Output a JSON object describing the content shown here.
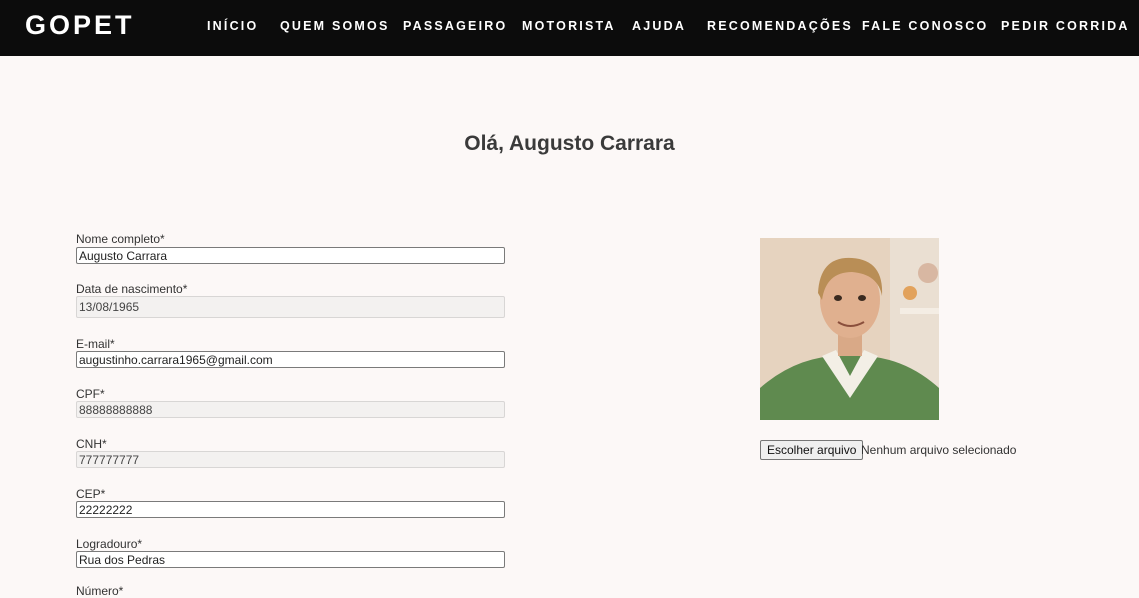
{
  "nav": {
    "logo": "GOPET",
    "items": [
      {
        "label": "INÍCIO"
      },
      {
        "label": "QUEM SOMOS"
      },
      {
        "label": "PASSAGEIRO"
      },
      {
        "label": "MOTORISTA"
      },
      {
        "label": "AJUDA"
      },
      {
        "label": "RECOMENDAÇÕES"
      },
      {
        "label": "FALE CONOSCO"
      },
      {
        "label": "PEDIR CORRIDA"
      }
    ]
  },
  "greeting": "Olá, Augusto Carrara",
  "form": {
    "fields": [
      {
        "label": "Nome completo*",
        "value": "Augusto Carrara"
      },
      {
        "label": "Data de nascimento*",
        "value": "13/08/1965"
      },
      {
        "label": "E-mail*",
        "value": "augustinho.carrara1965@gmail.com"
      },
      {
        "label": "CPF*",
        "value": "88888888888"
      },
      {
        "label": "CNH*",
        "value": "777777777"
      },
      {
        "label": "CEP*",
        "value": "22222222"
      },
      {
        "label": "Logradouro*",
        "value": "Rua dos Pedras"
      },
      {
        "label": "Número*",
        "value": ""
      }
    ]
  },
  "photo": {
    "button_label": "Escolher arquivo",
    "status": "Nenhum arquivo selecionado"
  }
}
